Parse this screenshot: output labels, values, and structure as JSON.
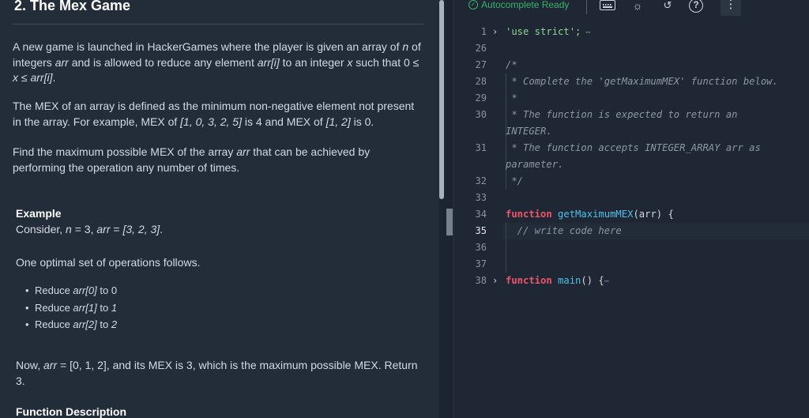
{
  "problem": {
    "title": "2. The Mex Game",
    "p1": {
      "a": "A new game is launched in HackerGames where the player is given an array of ",
      "n": "n",
      "b": " of integers ",
      "arr": "arr",
      "c": " and is allowed to reduce any element ",
      "arri": "arr[i]",
      "d": " to an integer ",
      "x": "x",
      "e": " such that 0 ≤ ",
      "x2": "x",
      "f": " ≤ ",
      "arri2": "arr[i]",
      "g": "."
    },
    "p2": {
      "a": "The MEX of an array is defined as the minimum non-negative element not present in the array. For example, MEX of ",
      "ex1": "[1, 0, 3, 2, 5]",
      "b": " is 4 and MEX of ",
      "ex2": "[1, 2]",
      "c": " is 0."
    },
    "p3": {
      "a": "Find the maximum possible MEX of the array ",
      "arr": "arr",
      "b": " that can be achieved by performing the operation any number of times."
    },
    "example_heading": "Example",
    "example": {
      "a": "Consider, ",
      "n": "n",
      "b": " = 3, ",
      "arr": "arr",
      "c": " = ",
      "val": "[3, 2, 3]",
      "d": "."
    },
    "p4": "One optimal set of operations follows.",
    "operations": [
      {
        "a": "Reduce ",
        "el": "arr[0]",
        "b": " to 0",
        "v": ""
      },
      {
        "a": "Reduce ",
        "el": "arr[1]",
        "b": " to ",
        "v": "1"
      },
      {
        "a": "Reduce ",
        "el": "arr[2]",
        "b": " to ",
        "v": "2"
      }
    ],
    "p5": {
      "a": "Now, ",
      "arr": "arr",
      "b": " = [0, 1, 2], and its MEX is 3, which is the maximum possible MEX. Return 3."
    },
    "function_description_heading": "Function Description"
  },
  "toolbar": {
    "autocomplete_status": "Autocomplete Ready",
    "check_icon": "check-circle-icon",
    "keyboard_icon": "keyboard-icon",
    "theme_icon": "sun-icon",
    "history_icon": "history-icon",
    "help_icon": "help-icon",
    "help_glyph": "?",
    "more_glyph": "⋮",
    "status_color": "#37b36a"
  },
  "editor": {
    "lines": [
      {
        "n": "1",
        "fold": "›",
        "parts": [
          [
            "str",
            "'use strict';"
          ],
          [
            "dots",
            " ⋯"
          ]
        ]
      },
      {
        "n": "26",
        "fold": "",
        "parts": []
      },
      {
        "n": "27",
        "fold": "",
        "parts": [
          [
            "cm",
            "/*"
          ]
        ]
      },
      {
        "n": "28",
        "fold": "",
        "parts": [
          [
            "cm",
            " * Complete the 'getMaximumMEX' function below."
          ]
        ]
      },
      {
        "n": "29",
        "fold": "",
        "parts": [
          [
            "cm",
            " *"
          ]
        ]
      },
      {
        "n": "30",
        "fold": "",
        "parts": [
          [
            "cm",
            " * The function is expected to return an"
          ]
        ]
      },
      {
        "n": "",
        "fold": "",
        "parts": [
          [
            "cm",
            "INTEGER."
          ]
        ]
      },
      {
        "n": "31",
        "fold": "",
        "parts": [
          [
            "cm",
            " * The function accepts INTEGER_ARRAY arr as"
          ]
        ]
      },
      {
        "n": "",
        "fold": "",
        "parts": [
          [
            "cm",
            "parameter."
          ]
        ]
      },
      {
        "n": "32",
        "fold": "",
        "parts": [
          [
            "cm",
            " */"
          ]
        ]
      },
      {
        "n": "33",
        "fold": "",
        "parts": []
      },
      {
        "n": "34",
        "fold": "",
        "parts": [
          [
            "kw",
            "function"
          ],
          [
            "muted",
            " "
          ],
          [
            "fn",
            "getMaximumMEX"
          ],
          [
            "muted",
            "(arr) {"
          ]
        ]
      },
      {
        "n": "35",
        "fold": "",
        "parts": [
          [
            "cm",
            "  // write code here"
          ]
        ]
      },
      {
        "n": "36",
        "fold": "",
        "parts": []
      },
      {
        "n": "37",
        "fold": "",
        "parts": []
      },
      {
        "n": "38",
        "fold": "›",
        "parts": [
          [
            "kw",
            "function"
          ],
          [
            "muted",
            " "
          ],
          [
            "fn",
            "main"
          ],
          [
            "muted",
            "() {"
          ],
          [
            "dots",
            "⋯"
          ]
        ]
      }
    ]
  }
}
